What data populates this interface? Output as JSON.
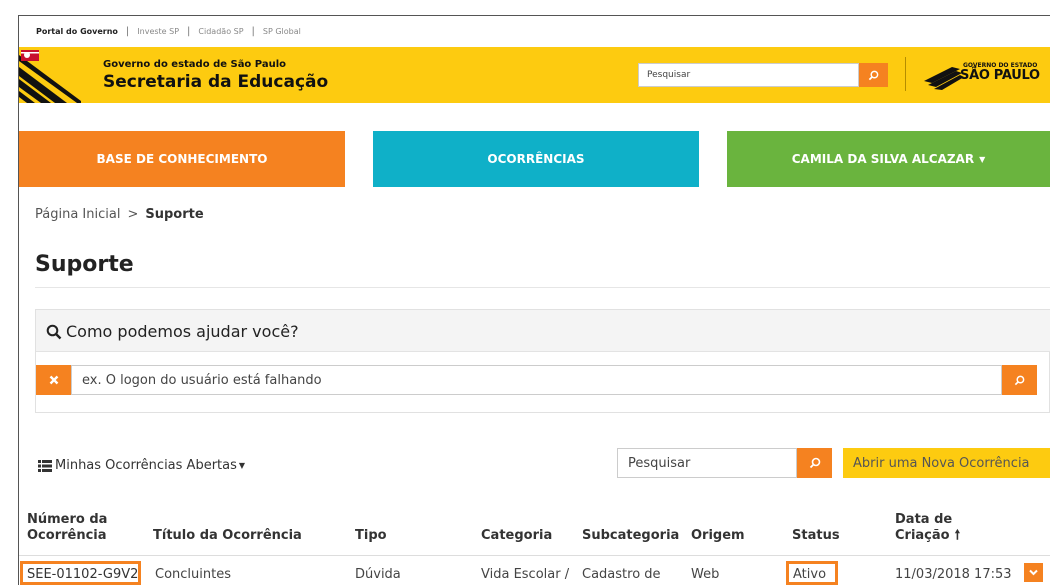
{
  "topbar": {
    "links": [
      "Portal do Governo",
      "Investe SP",
      "Cidadão SP",
      "SP Global"
    ]
  },
  "header": {
    "gov_line": "Governo do estado de São Paulo",
    "sec_line": "Secretaria da Educação",
    "search_placeholder": "Pesquisar",
    "sp_logo_small": "GOVERNO DO ESTADO",
    "sp_logo_big": "SÃO PAULO"
  },
  "nav": {
    "base": "BASE DE CONHECIMENTO",
    "ocorrencias": "OCORRÊNCIAS",
    "user": "CAMILA DA SILVA ALCAZAR"
  },
  "breadcrumb": {
    "home": "Página Inicial",
    "separator": ">",
    "current": "Suporte"
  },
  "page": {
    "title": "Suporte"
  },
  "help": {
    "title": "Como podemos ajudar você?",
    "input_placeholder": "ex. O logon do usuário está falhando"
  },
  "list": {
    "view_label": "Minhas Ocorrências Abertas",
    "search_value": "Pesquisar",
    "new_button": "Abrir uma Nova Ocorrência",
    "columns": {
      "numero_1": "Número da",
      "numero_2": "Ocorrência",
      "titulo": "Título da Ocorrência",
      "tipo": "Tipo",
      "categoria": "Categoria",
      "subcategoria": "Subcategoria",
      "origem": "Origem",
      "status": "Status",
      "data_1": "Data de",
      "data_2": "Criação"
    },
    "rows": [
      {
        "numero": "SEE-01102-G9V2",
        "titulo": "Concluintes",
        "tipo": "Dúvida",
        "categoria": "Vida Escolar /",
        "subcategoria": "Cadastro de",
        "origem": "Web",
        "status": "Ativo",
        "data": "11/03/2018 17:53"
      }
    ]
  },
  "colors": {
    "orange": "#f58220",
    "yellow": "#fdcb10",
    "teal": "#0fb0c8",
    "green": "#6ab43e"
  }
}
